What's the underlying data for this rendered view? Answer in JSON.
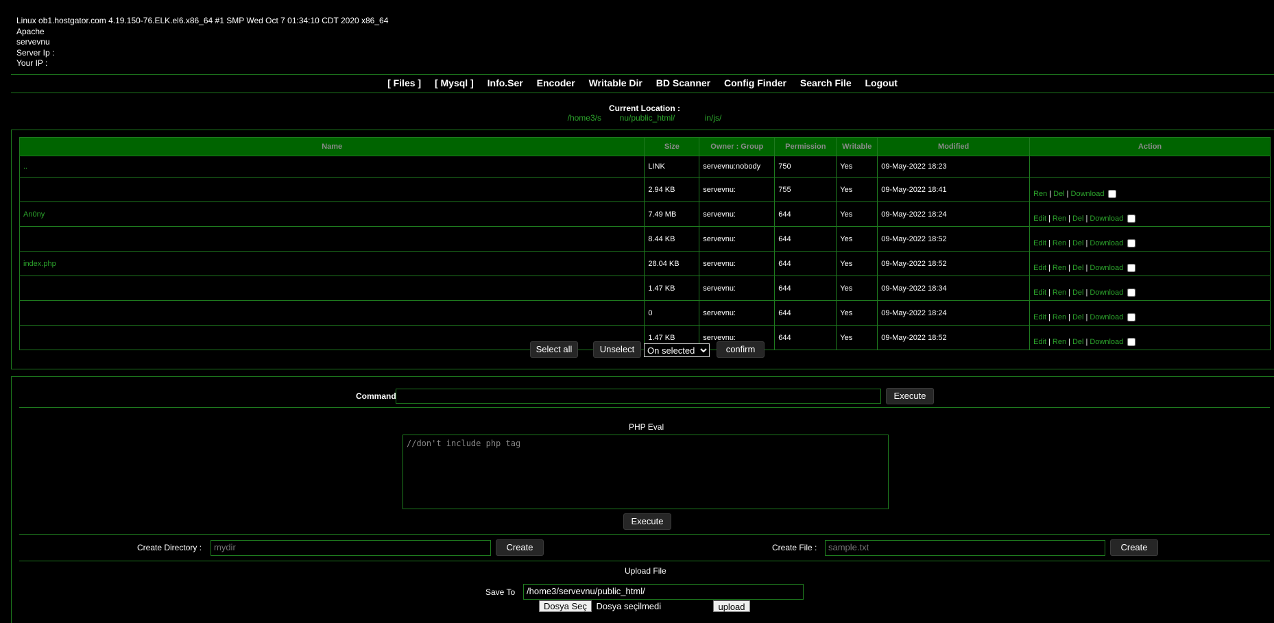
{
  "sysinfo": {
    "uname": "Linux ob1.hostgator.com 4.19.150-76.ELK.el6.x86_64 #1 SMP Wed Oct 7 01:34:10 CDT 2020 x86_64",
    "server_software": "Apache",
    "user": "servevnu",
    "server_ip_label": "Server Ip :",
    "your_ip_label": "Your IP :"
  },
  "nav": {
    "items": [
      "[ Files ]",
      "[ Mysql ]",
      "Info.Ser",
      "Encoder",
      "Writable Dir",
      "BD Scanner",
      "Config Finder",
      "Search File",
      "Logout"
    ]
  },
  "location": {
    "label": "Current Location :",
    "path": "/home3/s        nu/public_html/             in/js/"
  },
  "table": {
    "headers": [
      "Name",
      "Size",
      "Owner : Group",
      "Permission",
      "Writable",
      "Modified",
      "Action"
    ],
    "rows": [
      {
        "name": "..",
        "size": "LINK",
        "owner": "servevnu:nobody",
        "perm": "750",
        "writable": "Yes",
        "modified": "09-May-2022 18:23"
      },
      {
        "name": "",
        "size": "2.94 KB",
        "owner": "servevnu:",
        "perm": "755",
        "writable": "Yes",
        "modified": "09-May-2022 18:41"
      },
      {
        "name": "An0ny",
        "size": "7.49 MB",
        "owner": "servevnu:",
        "perm": "644",
        "writable": "Yes",
        "modified": "09-May-2022 18:24"
      },
      {
        "name": "",
        "size": "8.44 KB",
        "owner": "servevnu:",
        "perm": "644",
        "writable": "Yes",
        "modified": "09-May-2022 18:52"
      },
      {
        "name": "index.php",
        "size": "28.04 KB",
        "owner": "servevnu:",
        "perm": "644",
        "writable": "Yes",
        "modified": "09-May-2022 18:52"
      },
      {
        "name": "",
        "size": "1.47 KB",
        "owner": "servevnu:",
        "perm": "644",
        "writable": "Yes",
        "modified": "09-May-2022 18:34"
      },
      {
        "name": "",
        "size": "0",
        "owner": "servevnu:",
        "perm": "644",
        "writable": "Yes",
        "modified": "09-May-2022 18:24"
      },
      {
        "name": "",
        "size": "1.47 KB",
        "owner": "servevnu:",
        "perm": "644",
        "writable": "Yes",
        "modified": "09-May-2022 18:52"
      }
    ],
    "actions": {
      "edit": "Edit",
      "ren": "Ren",
      "del": "Del",
      "download": "Download",
      "sep": "|"
    }
  },
  "bulk": {
    "select_all": "Select all",
    "unselect": "Unselect",
    "selected_option": "On selected",
    "confirm": "confirm"
  },
  "command": {
    "label": "Command",
    "value": "",
    "execute": "Execute"
  },
  "eval": {
    "title": "PHP Eval",
    "placeholder": "//don't include php tag",
    "execute": "Execute"
  },
  "create_dir": {
    "label": "Create Directory :",
    "placeholder": "mydir",
    "button": "Create"
  },
  "create_file": {
    "label": "Create File :",
    "placeholder": "sample.txt",
    "button": "Create"
  },
  "upload": {
    "title": "Upload File",
    "save_to_label": "Save To",
    "save_to_value": "/home3/servevnu/public_html/",
    "choose_button": "Dosya Seç",
    "no_file": "Dosya seçilmedi",
    "upload_button": "upload"
  }
}
